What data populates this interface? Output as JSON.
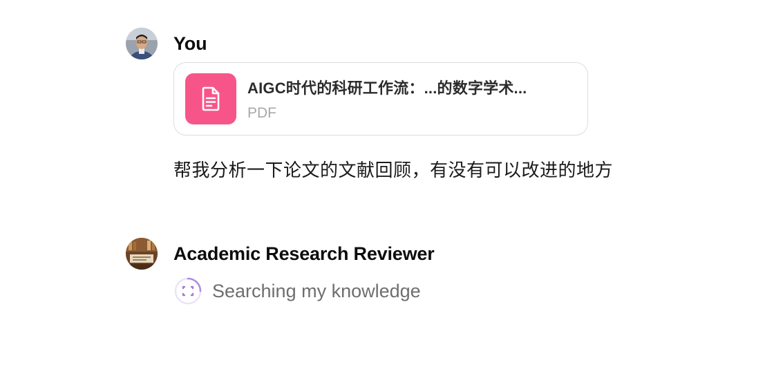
{
  "conversation": {
    "user_message": {
      "author": "You",
      "attachment": {
        "name": "AIGC时代的科研工作流：...的数字学术...",
        "type": "PDF",
        "icon": "document-icon",
        "icon_bg": "#f7558a"
      },
      "text": "帮我分析一下论文的文献回顾，有没有可以改进的地方"
    },
    "assistant_message": {
      "author": "Academic Research Reviewer",
      "status": "Searching my knowledge",
      "status_icon": "loading-spinner-icon",
      "accent": "#b08ae0"
    }
  }
}
